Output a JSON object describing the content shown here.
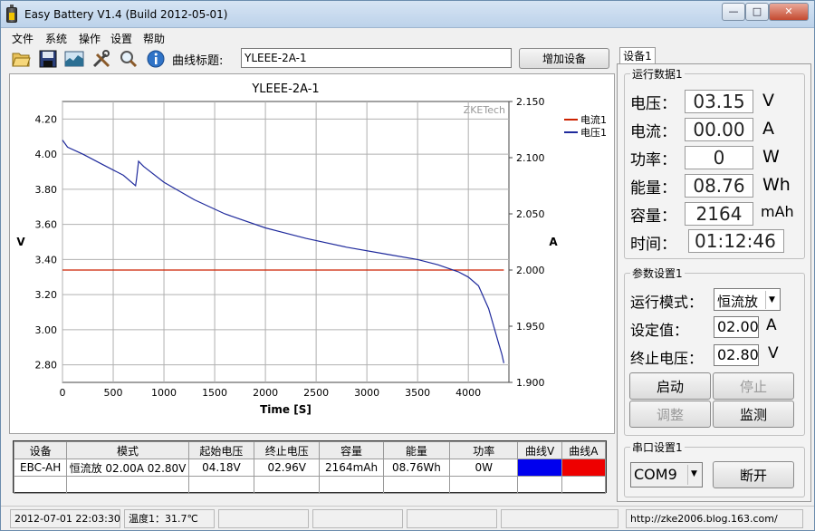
{
  "window": {
    "title": "Easy Battery V1.4 (Build 2012-05-01)",
    "controls": [
      "—",
      "□",
      "✕"
    ]
  },
  "menu": [
    "文件",
    "系统",
    "操作",
    "设置",
    "帮助"
  ],
  "toolbar": {
    "icons": [
      "folder-open-icon",
      "save-icon",
      "chart-icon",
      "tools-icon",
      "magnifier-icon",
      "info-icon"
    ],
    "curve_title_label": "曲线标题:",
    "curve_title_value": "YLEEE-2A-1",
    "add_device_label": "增加设备"
  },
  "chart_data": {
    "type": "line",
    "title": "YLEEE-2A-1",
    "watermark": "ZKETech",
    "xlabel": "Time [S]",
    "ylabel": "V",
    "y2label": "A",
    "xlim": [
      0,
      4400
    ],
    "ylim": [
      2.7,
      4.3
    ],
    "y2lim": [
      1.9,
      2.15
    ],
    "x_ticks": [
      0,
      500,
      1000,
      1500,
      2000,
      2500,
      3000,
      3500,
      4000
    ],
    "y_ticks": [
      "4.20",
      "4.00",
      "3.80",
      "3.60",
      "3.40",
      "3.20",
      "3.00",
      "2.80"
    ],
    "y2_ticks": [
      "2.150",
      "2.100",
      "2.050",
      "2.000",
      "1.950",
      "1.900"
    ],
    "grid": true,
    "legend_position": "top-right",
    "series": [
      {
        "name": "电流1",
        "axis": "right",
        "color": "#cc2200",
        "x": [
          0,
          4350
        ],
        "y": [
          2.0,
          2.0
        ]
      },
      {
        "name": "电压1",
        "axis": "left",
        "color": "#1f2a9c",
        "x": [
          0,
          50,
          200,
          400,
          600,
          720,
          730,
          750,
          800,
          1000,
          1300,
          1600,
          2000,
          2400,
          2800,
          3200,
          3500,
          3700,
          3900,
          4000,
          4100,
          4200,
          4250,
          4300,
          4330,
          4350
        ],
        "y": [
          4.08,
          4.04,
          4.0,
          3.94,
          3.88,
          3.82,
          3.86,
          3.96,
          3.93,
          3.84,
          3.74,
          3.66,
          3.58,
          3.52,
          3.47,
          3.43,
          3.4,
          3.37,
          3.33,
          3.3,
          3.25,
          3.12,
          3.02,
          2.92,
          2.86,
          2.81
        ]
      }
    ]
  },
  "table": {
    "headers": [
      "设备",
      "模式",
      "起始电压",
      "终止电压",
      "容量",
      "能量",
      "功率",
      "曲线V",
      "曲线A"
    ],
    "rows": [
      {
        "device": "EBC-AH",
        "mode": "恒流放  02.00A  02.80V",
        "start_voltage": "04.18V",
        "end_voltage": "02.96V",
        "capacity": "2164mAh",
        "energy": "08.76Wh",
        "power": "0W",
        "curve_v_color": "#0000ee",
        "curve_a_color": "#ee0000"
      }
    ]
  },
  "status": {
    "datetime": "2012-07-01 22:03:30",
    "temperature": "温度1：31.7℃",
    "url": "http://zke2006.blog.163.com/"
  },
  "panel": {
    "tab": "设备1",
    "run_group_title": "运行数据1",
    "run": [
      {
        "label": "电压：",
        "value": "03.15",
        "unit": "V"
      },
      {
        "label": "电流：",
        "value": "00.00",
        "unit": "A"
      },
      {
        "label": "功率：",
        "value": "0",
        "unit": "W"
      },
      {
        "label": "能量：",
        "value": "08.76",
        "unit": "Wh"
      },
      {
        "label": "容量：",
        "value": "2164",
        "unit": "mAh"
      },
      {
        "label": "时间：",
        "value": "01:12:46",
        "unit": ""
      }
    ],
    "param_group_title": "参数设置1",
    "mode_label": "运行模式：",
    "mode_value": "恒流放",
    "set_label": "设定值：",
    "set_value": "02.00",
    "set_unit": "A",
    "stop_label": "终止电压：",
    "stop_value": "02.80",
    "stop_unit": "V",
    "buttons": {
      "start": "启动",
      "stop": "停止",
      "adjust": "调整",
      "monitor": "监测"
    },
    "serial_group_title": "串口设置1",
    "port": "COM9",
    "disconnect": "断开"
  }
}
